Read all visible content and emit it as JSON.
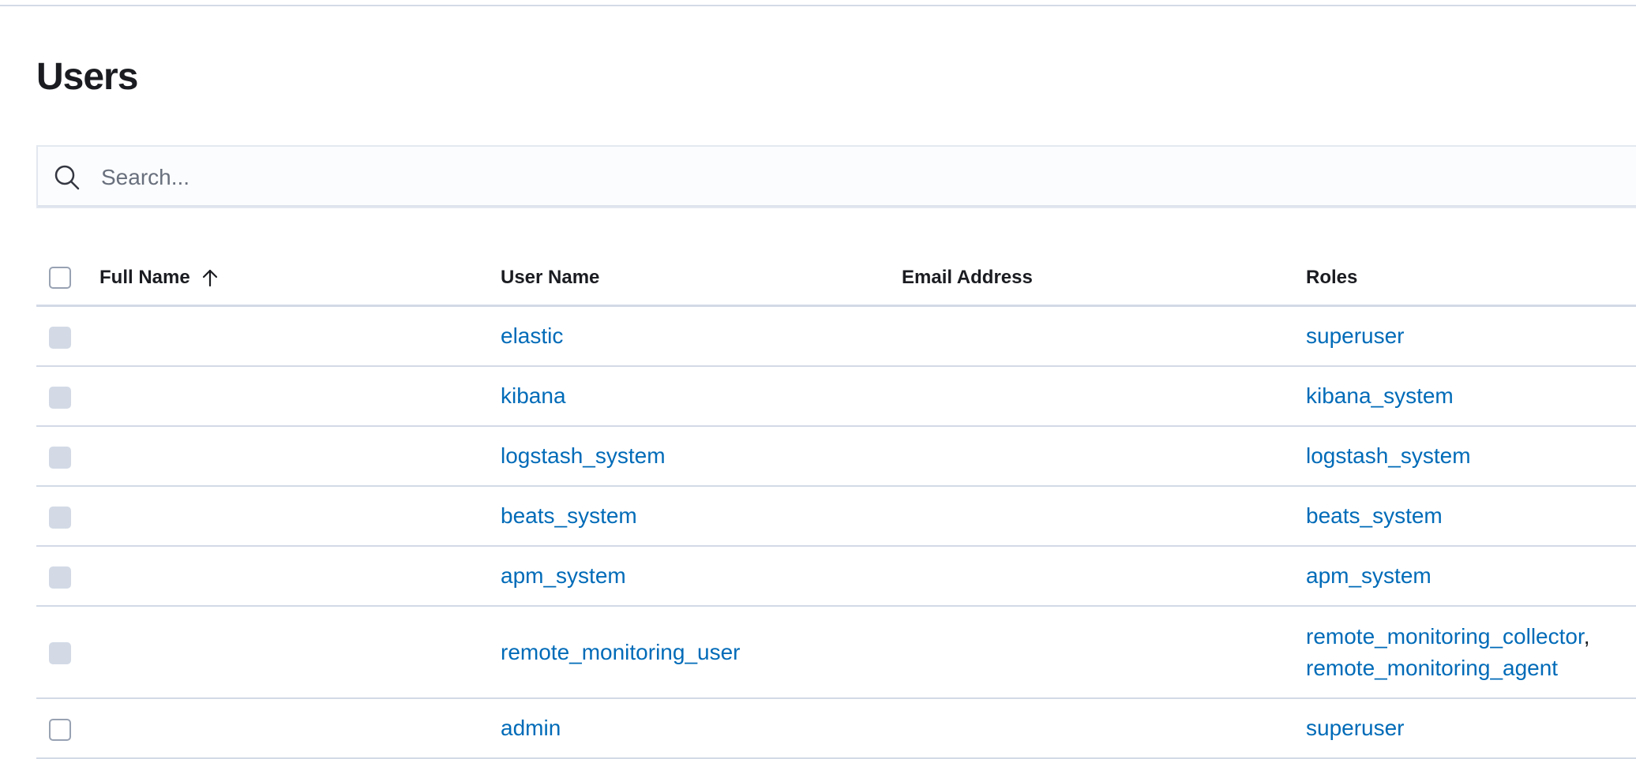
{
  "page": {
    "title": "Users"
  },
  "search": {
    "placeholder": "Search..."
  },
  "table": {
    "columns": {
      "full_name": "Full Name",
      "user_name": "User Name",
      "email": "Email Address",
      "roles": "Roles"
    },
    "sort": {
      "column": "Full Name",
      "direction": "ascending",
      "icon": "sort-up-arrow-icon"
    },
    "rows": [
      {
        "full_name": "",
        "user_name": "elastic",
        "email": "",
        "roles": [
          "superuser"
        ],
        "selectable": false
      },
      {
        "full_name": "",
        "user_name": "kibana",
        "email": "",
        "roles": [
          "kibana_system"
        ],
        "selectable": false
      },
      {
        "full_name": "",
        "user_name": "logstash_system",
        "email": "",
        "roles": [
          "logstash_system"
        ],
        "selectable": false
      },
      {
        "full_name": "",
        "user_name": "beats_system",
        "email": "",
        "roles": [
          "beats_system"
        ],
        "selectable": false
      },
      {
        "full_name": "",
        "user_name": "apm_system",
        "email": "",
        "roles": [
          "apm_system"
        ],
        "selectable": false
      },
      {
        "full_name": "",
        "user_name": "remote_monitoring_user",
        "email": "",
        "roles": [
          "remote_monitoring_collector",
          "remote_monitoring_agent"
        ],
        "role_separator": ",",
        "selectable": false
      },
      {
        "full_name": "",
        "user_name": "admin",
        "email": "",
        "roles": [
          "superuser"
        ],
        "selectable": true
      }
    ]
  },
  "colors": {
    "link": "#006bb8",
    "border": "#d3dae6",
    "disabled_checkbox": "#d3dae6",
    "text": "#1a1c21"
  }
}
